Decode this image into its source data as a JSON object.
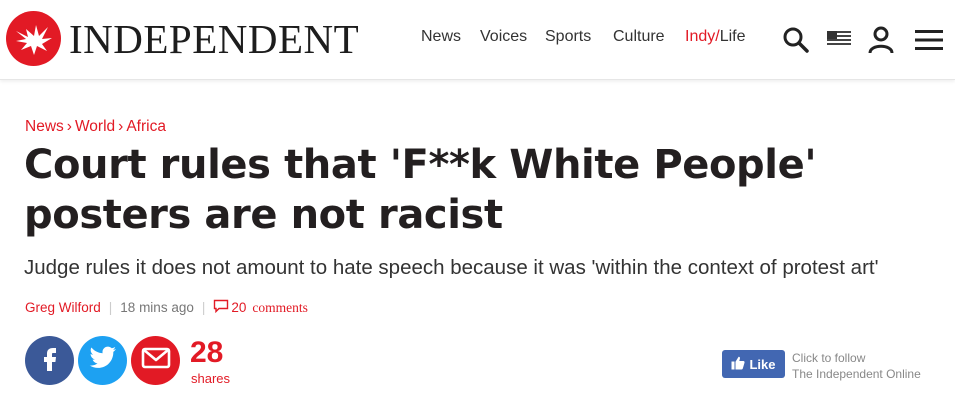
{
  "header": {
    "brand": "INDEPENDENT",
    "logo_icon": "eagle-logo-icon",
    "nav": [
      {
        "label": "News"
      },
      {
        "label": "Voices"
      },
      {
        "label": "Sports"
      },
      {
        "label": "Culture"
      }
    ],
    "indy_label": "Indy/",
    "life_label": "Life",
    "icons": [
      "search-icon",
      "us-flag-icon",
      "user-icon",
      "menu-icon"
    ],
    "colors": {
      "accent": "#e21a25",
      "text": "#231f20"
    }
  },
  "breadcrumb": {
    "items": [
      "News",
      "World",
      "Africa"
    ],
    "separator": "›"
  },
  "article": {
    "headline_line1": "Court rules that 'F**k White People'",
    "headline_line2": "posters are not racist",
    "standfirst": "Judge rules it does not amount to hate speech because it was 'within the context of protest art'",
    "author": "Greg Wilford",
    "time": "18 mins ago",
    "divider": "|",
    "comment_count": "20",
    "comment_word": "comments"
  },
  "share": {
    "buttons": [
      {
        "name": "facebook",
        "color": "#3b5998"
      },
      {
        "name": "twitter",
        "color": "#1da1f2"
      },
      {
        "name": "email",
        "color": "#e21a25"
      }
    ],
    "count": "28",
    "label": "shares"
  },
  "follow": {
    "like_label": "Like",
    "line1": "Click to follow",
    "line2": "The Independent Online"
  }
}
